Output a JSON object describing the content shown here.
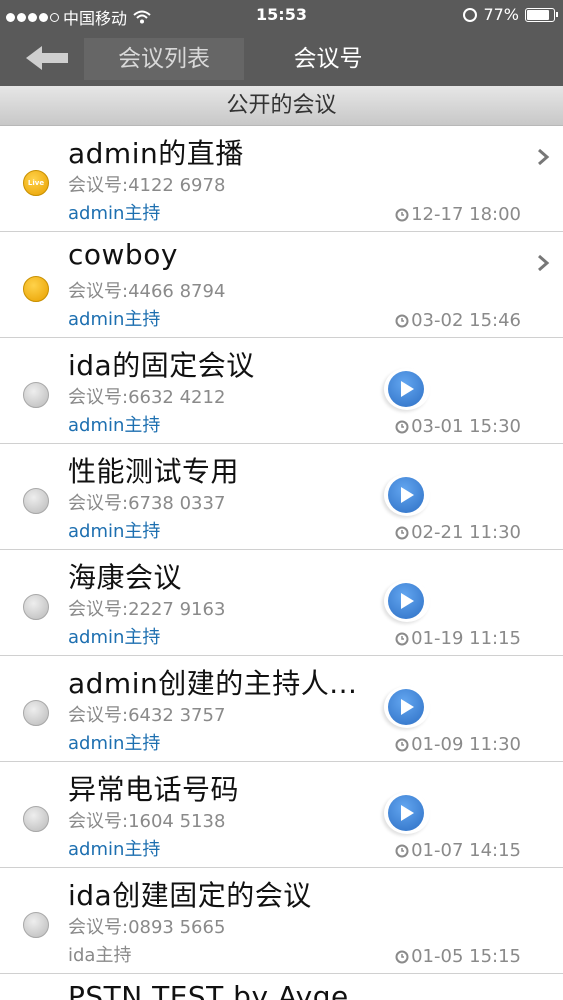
{
  "status_bar": {
    "carrier": "中国移动",
    "time": "15:53",
    "battery": "77%",
    "battery_level": 0.77
  },
  "nav": {
    "tab_list": "会议列表",
    "tab_number": "会议号"
  },
  "section_title": "公开的会议",
  "colors": {
    "bar_bg": "#5a5a5a",
    "host_blue": "#1d6fb0",
    "live_yellow": "#f0b400",
    "play_blue": "#2d6fc4"
  },
  "meetings": [
    {
      "title": "admin的直播",
      "number": "会议号:4122 6978",
      "host": "admin主持",
      "time": "12-17 18:00",
      "status": "live",
      "badge": "Live",
      "action": "chevron-right-icon"
    },
    {
      "title": "cowboy",
      "number": "会议号:4466 8794",
      "host": "admin主持",
      "time": "03-02 15:46",
      "status": "live",
      "badge": "",
      "action": "chevron-right-icon"
    },
    {
      "title": "ida的固定会议",
      "number": "会议号:6632 4212",
      "host": "admin主持",
      "time": "03-01 15:30",
      "status": "idle",
      "action": "play-icon"
    },
    {
      "title": "性能测试专用",
      "number": "会议号:6738 0337",
      "host": "admin主持",
      "time": "02-21 11:30",
      "status": "idle",
      "action": "play-icon"
    },
    {
      "title": "海康会议",
      "number": "会议号:2227 9163",
      "host": "admin主持",
      "time": "01-19 11:15",
      "status": "idle",
      "action": "play-icon"
    },
    {
      "title": "admin创建的主持人...",
      "number": "会议号:6432 3757",
      "host": "admin主持",
      "time": "01-09 11:30",
      "status": "idle",
      "action": "play-icon"
    },
    {
      "title": "异常电话号码",
      "number": "会议号:1604 5138",
      "host": "admin主持",
      "time": "01-07 14:15",
      "status": "idle",
      "action": "play-icon"
    },
    {
      "title": "ida创建固定的会议",
      "number": "会议号:0893 5665",
      "host": "ida主持",
      "time": "01-05 15:15",
      "status": "idle",
      "action": "none"
    },
    {
      "title": "PSTN TEST by Ayge"
    }
  ]
}
